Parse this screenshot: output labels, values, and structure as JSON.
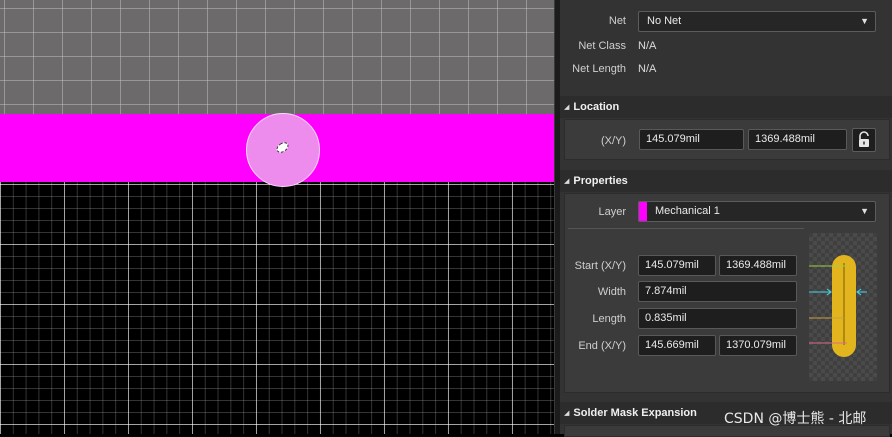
{
  "net_section": {
    "net_label": "Net",
    "net_value": "No Net",
    "net_class_label": "Net Class",
    "net_class_value": "N/A",
    "net_length_label": "Net Length",
    "net_length_value": "N/A"
  },
  "location": {
    "title": "Location",
    "xy_label": "(X/Y)",
    "x": "145.079mil",
    "y": "1369.488mil",
    "lock_icon": "unlock-icon"
  },
  "properties": {
    "title": "Properties",
    "layer_label": "Layer",
    "layer_value": "Mechanical 1",
    "layer_color": "#ff00ff",
    "start_label": "Start (X/Y)",
    "start_x": "145.079mil",
    "start_y": "1369.488mil",
    "width_label": "Width",
    "width_value": "7.874mil",
    "length_label": "Length",
    "length_value": "0.835mil",
    "end_label": "End (X/Y)",
    "end_x": "145.669mil",
    "end_y": "1370.079mil"
  },
  "solder_mask": {
    "title": "Solder Mask Expansion"
  },
  "watermark": "CSDN @博士熊 - 北邮",
  "colors": {
    "track": "#ff00ff",
    "pad": "#ee8cee",
    "panel_bg": "#333333",
    "diagram_track": "#e2b51f"
  }
}
